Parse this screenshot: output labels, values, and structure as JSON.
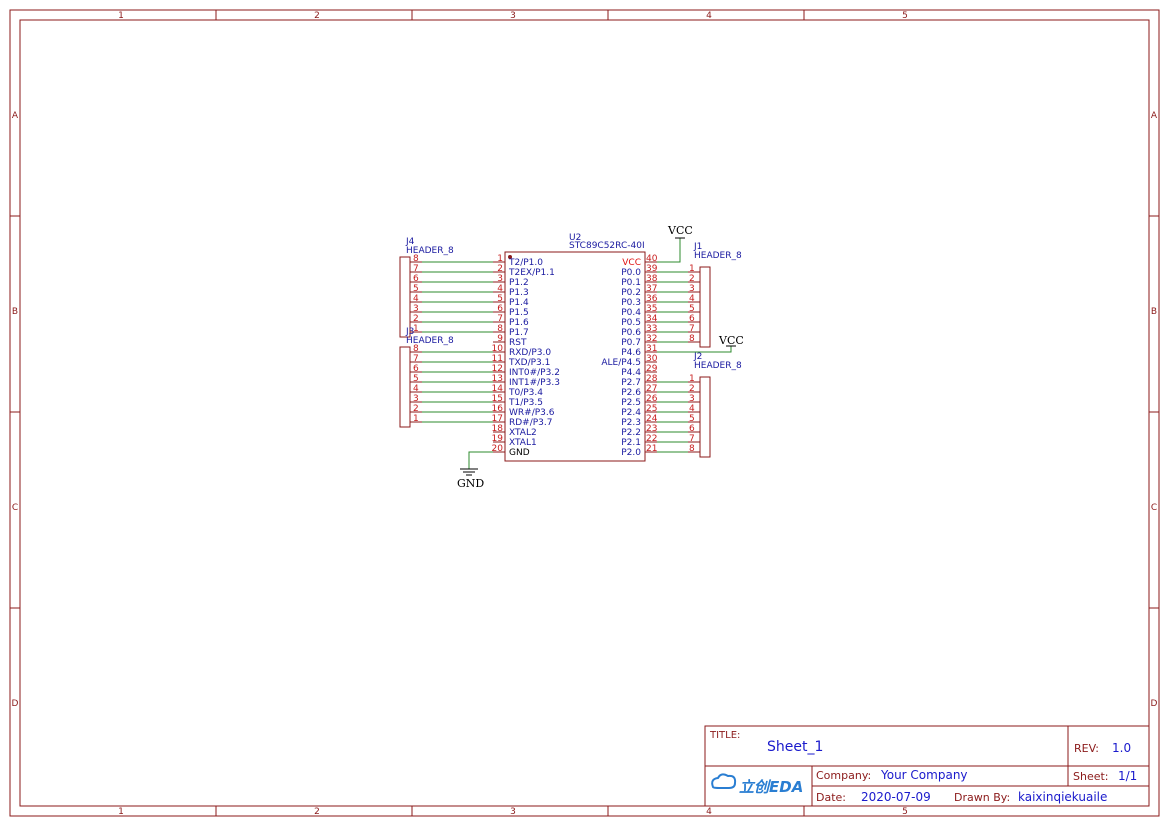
{
  "colors": {
    "border": "#8b1a1a",
    "pin_number": "#c81e1e",
    "label_blue": "#1a1aa0",
    "wire": "#2e8b2e",
    "text_dark": "#000000",
    "vcc_pin": "#e01010"
  },
  "frame": {
    "columns": [
      "1",
      "2",
      "3",
      "4",
      "5"
    ],
    "rows": [
      "A",
      "B",
      "C",
      "D"
    ]
  },
  "u2": {
    "designator": "U2",
    "value": "STC89C52RC-40I",
    "left_pins": [
      {
        "num": "1",
        "name": "T2/P1.0"
      },
      {
        "num": "2",
        "name": "T2EX/P1.1"
      },
      {
        "num": "3",
        "name": "P1.2"
      },
      {
        "num": "4",
        "name": "P1.3"
      },
      {
        "num": "5",
        "name": "P1.4"
      },
      {
        "num": "6",
        "name": "P1.5"
      },
      {
        "num": "7",
        "name": "P1.6"
      },
      {
        "num": "8",
        "name": "P1.7"
      },
      {
        "num": "9",
        "name": "RST"
      },
      {
        "num": "10",
        "name": "RXD/P3.0"
      },
      {
        "num": "11",
        "name": "TXD/P3.1"
      },
      {
        "num": "12",
        "name": "INT0#/P3.2"
      },
      {
        "num": "13",
        "name": "INT1#/P3.3"
      },
      {
        "num": "14",
        "name": "T0/P3.4"
      },
      {
        "num": "15",
        "name": "T1/P3.5"
      },
      {
        "num": "16",
        "name": "WR#/P3.6"
      },
      {
        "num": "17",
        "name": "RD#/P3.7"
      },
      {
        "num": "18",
        "name": "XTAL2"
      },
      {
        "num": "19",
        "name": "XTAL1"
      },
      {
        "num": "20",
        "name": "GND"
      }
    ],
    "right_pins": [
      {
        "num": "40",
        "name": "VCC"
      },
      {
        "num": "39",
        "name": "P0.0"
      },
      {
        "num": "38",
        "name": "P0.1"
      },
      {
        "num": "37",
        "name": "P0.2"
      },
      {
        "num": "36",
        "name": "P0.3"
      },
      {
        "num": "35",
        "name": "P0.4"
      },
      {
        "num": "34",
        "name": "P0.5"
      },
      {
        "num": "33",
        "name": "P0.6"
      },
      {
        "num": "32",
        "name": "P0.7"
      },
      {
        "num": "31",
        "name": "P4.6"
      },
      {
        "num": "30",
        "name": "ALE/P4.5"
      },
      {
        "num": "29",
        "name": "P4.4"
      },
      {
        "num": "28",
        "name": "P2.7"
      },
      {
        "num": "27",
        "name": "P2.6"
      },
      {
        "num": "26",
        "name": "P2.5"
      },
      {
        "num": "25",
        "name": "P2.4"
      },
      {
        "num": "24",
        "name": "P2.3"
      },
      {
        "num": "23",
        "name": "P2.2"
      },
      {
        "num": "22",
        "name": "P2.1"
      },
      {
        "num": "21",
        "name": "P2.0"
      }
    ]
  },
  "headers": {
    "j4": {
      "designator": "J4",
      "value": "HEADER_8",
      "pins": [
        "8",
        "7",
        "6",
        "5",
        "4",
        "3",
        "2",
        "1"
      ]
    },
    "j3": {
      "designator": "J3",
      "value": "HEADER_8",
      "pins": [
        "8",
        "7",
        "6",
        "5",
        "4",
        "3",
        "2",
        "1"
      ]
    },
    "j1": {
      "designator": "J1",
      "value": "HEADER_8",
      "pins": [
        "1",
        "2",
        "3",
        "4",
        "5",
        "6",
        "7",
        "8"
      ]
    },
    "j2": {
      "designator": "J2",
      "value": "HEADER_8",
      "pins": [
        "1",
        "2",
        "3",
        "4",
        "5",
        "6",
        "7",
        "8"
      ]
    }
  },
  "power": {
    "vcc1": "VCC",
    "vcc2": "VCC",
    "gnd": "GND"
  },
  "title_block": {
    "title_label": "TITLE:",
    "title_value": "Sheet_1",
    "rev_label": "REV:",
    "rev_value": "1.0",
    "logo_text": "立创EDA",
    "company_label": "Company:",
    "company_value": "Your Company",
    "sheet_label": "Sheet:",
    "sheet_value": "1/1",
    "date_label": "Date:",
    "date_value": "2020-07-09",
    "drawn_label": "Drawn By:",
    "drawn_value": "kaixinqiekuaile"
  }
}
